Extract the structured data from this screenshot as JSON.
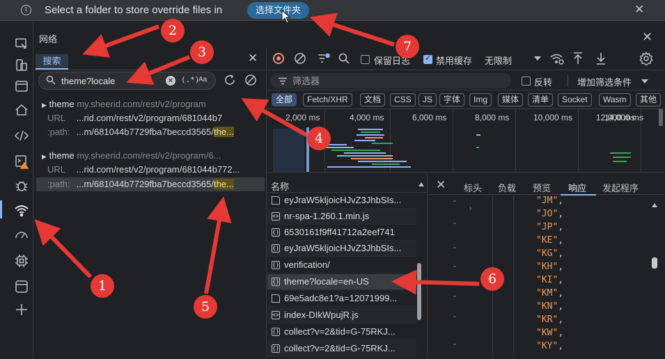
{
  "infobar": {
    "message": "Select a folder to store override files in",
    "button_label": "选择文件夹",
    "close_glyph": "✕"
  },
  "panel": {
    "title": "网络",
    "close_glyph": "✕"
  },
  "search": {
    "tab_label": "搜索",
    "close_glyph": "✕",
    "query": "theme?locale",
    "regex_label": "(.*)",
    "case_label": "Aa",
    "results": [
      {
        "name": "theme",
        "host": "my.sheerid.com/rest/v2/program",
        "url_label": "URL",
        "url_value": "...rid.com/rest/v2/program/681044b7",
        "path_label": ":path:",
        "path_prefix": "...m/681044b7729fba7beccd3565/",
        "path_match": "the..."
      },
      {
        "name": "theme",
        "host": "my.sheerid.com/rest/v2/program/6...",
        "url_label": "URL",
        "url_value": "...rid.com/rest/v2/program/681044b772...",
        "path_label": ":path:",
        "path_prefix": "...m/681044b7729fba7beccd3565/",
        "path_match": "the..."
      }
    ]
  },
  "toolbar": {
    "preserve_log": "保留日志",
    "disable_cache": "禁用缓存",
    "throttle": "无限制"
  },
  "filter": {
    "placeholder": "筛选器",
    "invert_label": "反转",
    "more_filters": "增加筛选条件"
  },
  "type_filters": [
    "全部",
    "Fetch/XHR",
    "文档",
    "CSS",
    "JS",
    "字体",
    "Img",
    "媒体",
    "清单",
    "Socket",
    "Wasm",
    "其他"
  ],
  "timeline": {
    "ticks": [
      "2,000 ms",
      "4,000 ms",
      "6,000 ms",
      "8,000 ms",
      "10,000 ms",
      "12,000 ms",
      "14,000 ms"
    ]
  },
  "requests": {
    "header": "名称",
    "rows": [
      {
        "name": "eyJraW5kljoicHJvZ3JhbSIs...",
        "icon": "doc"
      },
      {
        "name": "nr-spa-1.260.1.min.js",
        "icon": "script"
      },
      {
        "name": "6530161f9ff41712a2eef741",
        "icon": "fetch"
      },
      {
        "name": "eyJraW5kljoicHJvZ3JhbSIs...",
        "icon": "fetch"
      },
      {
        "name": "verification/",
        "icon": "fetch"
      },
      {
        "name": "theme?locale=en-US",
        "icon": "fetch"
      },
      {
        "name": "69e5adc8e1?a=12071999...",
        "icon": "doc"
      },
      {
        "name": "index-DIkWpujR.js",
        "icon": "script"
      },
      {
        "name": "collect?v=2&tid=G-75RKJ...",
        "icon": "fetch"
      },
      {
        "name": "collect?v=2&tid=G-75RKJ...",
        "icon": "fetch"
      }
    ],
    "selected_index": 5
  },
  "detail": {
    "close_glyph": "✕",
    "tabs": [
      "标头",
      "负载",
      "预览",
      "响应",
      "发起程序"
    ],
    "active_tab": "响应",
    "lines": [
      "\"JM\"",
      "\"JO\"",
      "\"JP\"",
      "\"KE\"",
      "\"KG\"",
      "\"KH\"",
      "\"KI\"",
      "\"KM\"",
      "\"KN\"",
      "\"KR\"",
      "\"KW\"",
      "\"KY\""
    ],
    "dash": "-",
    "comma": ","
  },
  "annotations": [
    "1",
    "2",
    "3",
    "4",
    "5",
    "6",
    "7"
  ],
  "colors": {
    "accent": "#8ab4f8",
    "annotation_red": "#e53935",
    "record_red": "#f28b82",
    "match_highlight": "#5f5215",
    "json_string": "#ee9a5a"
  },
  "icons": {
    "activity_bar": [
      "screenshot-icon",
      "device-toggle-icon",
      "window-icon",
      "home-icon",
      "code-icon",
      "console-icon",
      "bug-icon",
      "wifi-network-icon",
      "gauge-icon",
      "cpu-icon",
      "panel-icon",
      "plus-icon"
    ]
  }
}
